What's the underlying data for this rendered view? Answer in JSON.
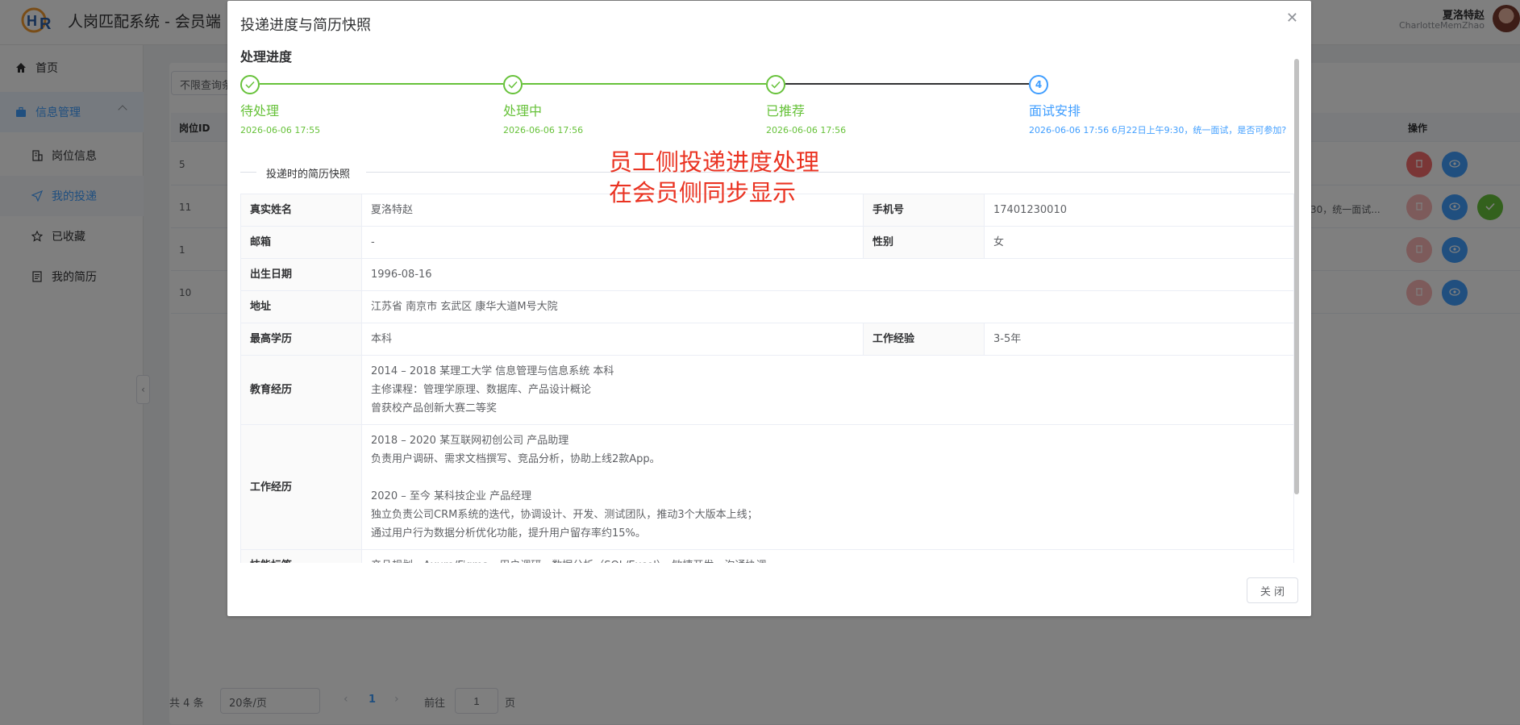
{
  "header": {
    "app_title": "人岗匹配系统 - 会员端",
    "user_name": "夏洛特赵",
    "user_en": "CharlotteMemZhao"
  },
  "sidebar": {
    "home": "首页",
    "group": "信息管理",
    "items": [
      {
        "label": "岗位信息"
      },
      {
        "label": "我的投递"
      },
      {
        "label": "已收藏"
      },
      {
        "label": "我的简历"
      }
    ]
  },
  "background_table": {
    "filter_placeholder": "不限查询条件",
    "col_id": "岗位ID",
    "col_op": "操作",
    "rows": [
      {
        "id": "5"
      },
      {
        "id": "11",
        "note": "30，统一面试..."
      },
      {
        "id": "1"
      },
      {
        "id": "10"
      }
    ]
  },
  "pagination": {
    "total": "共 4 条",
    "page_size": "20条/页",
    "current": "1",
    "goto_label": "前往",
    "goto_value": "1",
    "page_suffix": "页"
  },
  "dialog": {
    "title": "投递进度与简历快照",
    "section_title": "处理进度",
    "steps": [
      {
        "title": "待处理",
        "time": "2026-06-06 17:55",
        "status": "done"
      },
      {
        "title": "处理中",
        "time": "2026-06-06 17:56",
        "status": "done"
      },
      {
        "title": "已推荐",
        "time": "2026-06-06 17:56",
        "status": "done"
      },
      {
        "title": "面试安排",
        "index": "4",
        "time": "2026-06-06 17:56 6月22日上午9:30，统一面试，是否可参加?",
        "status": "current"
      }
    ],
    "divider_text": "投递时的简历快照",
    "fields": {
      "name_label": "真实姓名",
      "name": "夏洛特赵",
      "phone_label": "手机号",
      "phone": "17401230010",
      "email_label": "邮箱",
      "email": "-",
      "gender_label": "性别",
      "gender": "女",
      "birth_label": "出生日期",
      "birth": "1996-08-16",
      "address_label": "地址",
      "address": "江苏省 南京市 玄武区 康华大道M号大院",
      "edu_label": "最高学历",
      "edu": "本科",
      "exp_label": "工作经验",
      "exp": "3-5年",
      "edu_history_label": "教育经历",
      "edu_history": "2014 – 2018 某理工大学 信息管理与信息系统 本科\n主修课程：管理学原理、数据库、产品设计概论\n曾获校产品创新大赛二等奖",
      "work_history_label": "工作经历",
      "work_history": "2018 – 2020 某互联网初创公司 产品助理\n负责用户调研、需求文档撰写、竞品分析，协助上线2款App。\n\n2020 – 至今 某科技企业 产品经理\n独立负责公司CRM系统的迭代，协调设计、开发、测试团队，推动3个大版本上线；\n通过用户行为数据分析优化功能，提升用户留存率约15%。",
      "skills_label": "技能标签",
      "skills": "产品规划、Axure/Figma、用户调研、数据分析（SQL/Excel）、敏捷开发、沟通协调"
    },
    "close_button": "关 闭"
  },
  "annotation": {
    "line1": "员工侧投递进度处理",
    "line2": "在会员侧同步显示"
  },
  "colors": {
    "primary": "#409eff",
    "success": "#67c23a",
    "danger": "#f56c6c",
    "annotation": "#ea3322"
  }
}
